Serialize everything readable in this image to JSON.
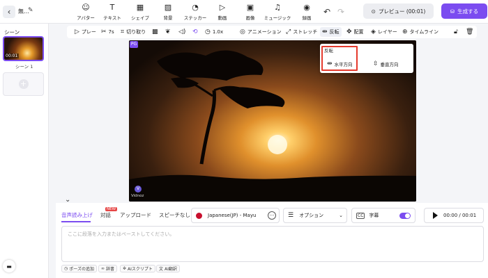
{
  "header": {
    "project_name": "無…",
    "tools": [
      {
        "label": "アバター",
        "icon": "avatar-icon"
      },
      {
        "label": "テキスト",
        "icon": "text-icon"
      },
      {
        "label": "シェイプ",
        "icon": "shape-icon"
      },
      {
        "label": "背景",
        "icon": "background-icon"
      },
      {
        "label": "ステッカー",
        "icon": "sticker-icon"
      },
      {
        "label": "動画",
        "icon": "video-icon"
      },
      {
        "label": "画像",
        "icon": "image-icon"
      },
      {
        "label": "ミュージック",
        "icon": "music-icon"
      },
      {
        "label": "録画",
        "icon": "record-icon"
      }
    ],
    "preview_label": "プレビュー (00:01)",
    "generate_label": "生成する",
    "accent_color": "#7b4cf0"
  },
  "sidebar": {
    "title": "シーン",
    "scenes": [
      {
        "label": "シーン 1",
        "duration": "00:01"
      }
    ]
  },
  "context_toolbar": {
    "items": [
      {
        "label": "プレー",
        "icon": "play-icon"
      },
      {
        "label": "7s",
        "icon": "scissors-icon"
      },
      {
        "label": "切り取り",
        "icon": "crop-icon"
      },
      {
        "label": "",
        "icon": "checkerboard-icon"
      },
      {
        "label": "",
        "icon": "droplets-icon"
      },
      {
        "label": "",
        "icon": "volume-icon"
      },
      {
        "label": "",
        "icon": "loop-icon"
      },
      {
        "label": "1.0x",
        "icon": "speed-icon"
      },
      {
        "label": "アニメーション",
        "icon": "animation-icon"
      },
      {
        "label": "ストレッチ",
        "icon": "stretch-icon"
      },
      {
        "label": "反転",
        "icon": "flip-icon"
      },
      {
        "label": "配置",
        "icon": "move-icon"
      },
      {
        "label": "レイヤー",
        "icon": "layers-icon"
      },
      {
        "label": "タイムライン",
        "icon": "timeline-icon"
      },
      {
        "label": "",
        "icon": "lock-icon"
      },
      {
        "label": "",
        "icon": "trash-icon"
      }
    ]
  },
  "flip_popup": {
    "title": "反転",
    "horizontal": "水平方向",
    "vertical": "垂直方向"
  },
  "canvas": {
    "watermark_text": "Vidnoz"
  },
  "bottom_panel": {
    "tabs": [
      "音声読み上げ",
      "対話",
      "アップロード",
      "スピーチなし"
    ],
    "new_badge": "NEW",
    "voice": "Japanese(JP) - Mayu",
    "options_label": "オプション",
    "subtitle_label": "字幕",
    "subtitle_enabled": true,
    "time": "00:00 / 00:01",
    "placeholder": "ここに段落を入力またはペーストしてください。",
    "chips": [
      "ポーズの追加",
      "辞書",
      "AIスクリプト",
      "AI翻訳"
    ]
  }
}
